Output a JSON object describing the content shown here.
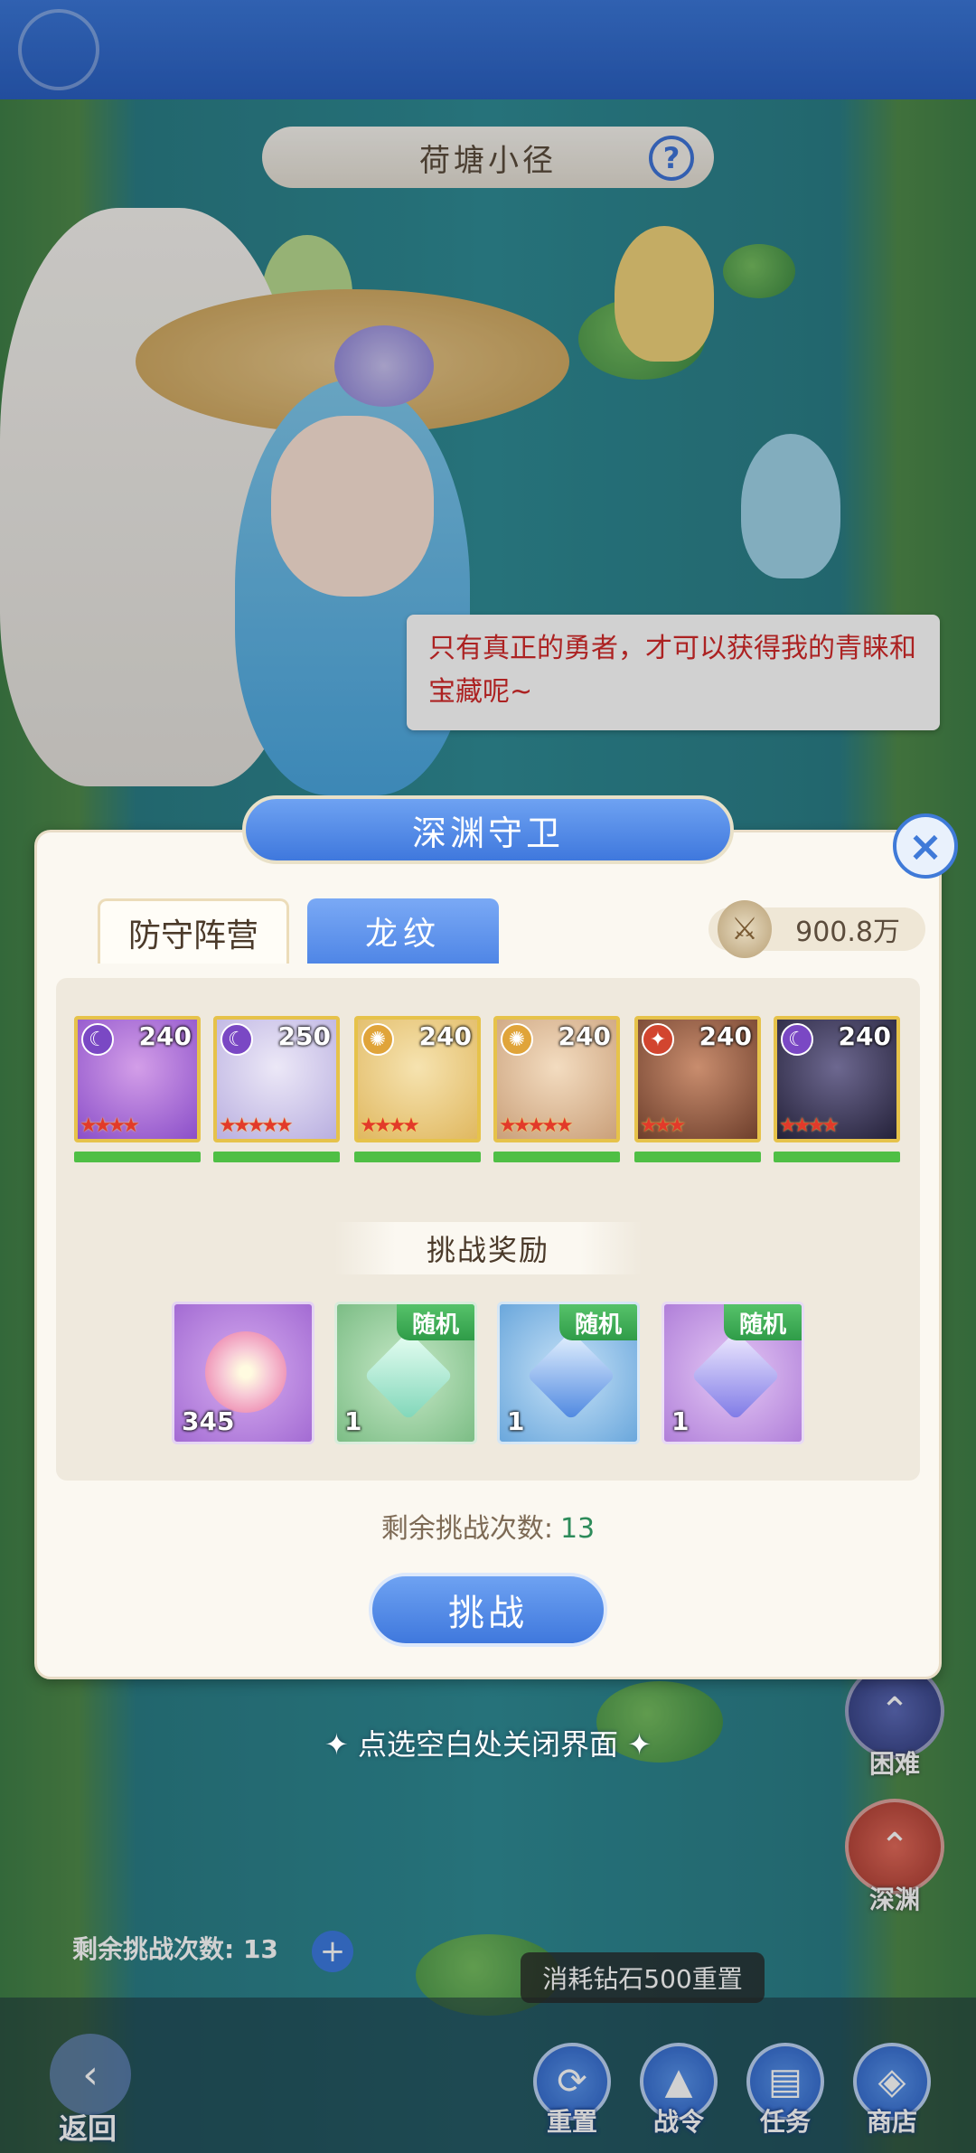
{
  "stage": {
    "title": "荷塘小径",
    "help_icon": "?"
  },
  "speech": {
    "text": "只有真正的勇者，才可以获得我的青睐和宝藏呢~"
  },
  "dialog": {
    "title": "深渊守卫",
    "close_icon": "×",
    "tabs": [
      {
        "label": "防守阵营",
        "active": true
      },
      {
        "label": "龙纹",
        "active": false
      }
    ],
    "power": "900.8万",
    "heroes": [
      {
        "level": "240",
        "element": "moon-icon",
        "stars": "★★★★",
        "color": "#8b4fc9"
      },
      {
        "level": "250",
        "element": "moon-icon",
        "stars": "★★★★★",
        "color": "#c7c0e6"
      },
      {
        "level": "240",
        "element": "sun-icon",
        "stars": "★★★★",
        "color": "#e6c27a"
      },
      {
        "level": "240",
        "element": "sun-icon",
        "stars": "★★★★★",
        "color": "#d9b48a"
      },
      {
        "level": "240",
        "element": "fire-icon",
        "stars": "★★★",
        "color": "#7a4a34"
      },
      {
        "level": "240",
        "element": "moon-icon",
        "stars": "★★★★",
        "color": "#2c2a44"
      }
    ],
    "reward_title": "挑战奖励",
    "rewards": [
      {
        "qty": "345",
        "tag": "",
        "icon": "flower-icon",
        "bg": "#a86bd6"
      },
      {
        "qty": "1",
        "tag": "随机",
        "icon": "green-crystal-icon",
        "bg": "#7fbf88"
      },
      {
        "qty": "1",
        "tag": "随机",
        "icon": "blue-gem-icon",
        "bg": "#6aa7dc"
      },
      {
        "qty": "1",
        "tag": "随机",
        "icon": "purple-gem-icon",
        "bg": "#b07fd9"
      }
    ],
    "remaining_label": "剩余挑战次数:",
    "remaining_count": "13",
    "challenge_label": "挑战"
  },
  "close_hint": "点选空白处关闭界面",
  "bottom": {
    "remaining_label": "剩余挑战次数:",
    "remaining_count": "13",
    "reset_tip": "消耗钻石500重置",
    "back_label": "返回",
    "buttons": [
      {
        "label": "重置",
        "icon": "refresh-icon"
      },
      {
        "label": "战令",
        "icon": "battle-pass-icon"
      },
      {
        "label": "任务",
        "icon": "task-icon"
      },
      {
        "label": "商店",
        "icon": "shop-icon"
      }
    ]
  },
  "side_modes": [
    {
      "label": "困难",
      "icon": "hard-mode-icon"
    },
    {
      "label": "深渊",
      "icon": "abyss-mode-icon"
    }
  ]
}
